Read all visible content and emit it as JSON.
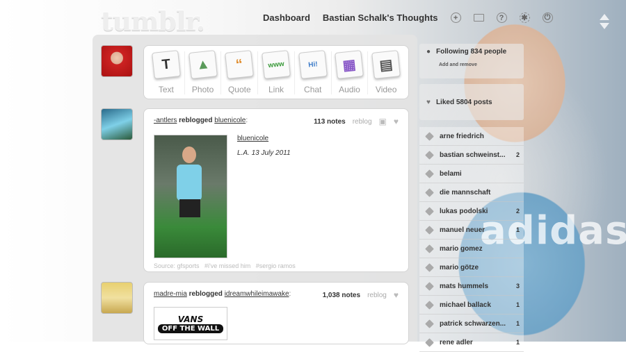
{
  "logo": "tumblr.",
  "nav": {
    "dashboard": "Dashboard",
    "blog": "Bastian Schalk's Thoughts"
  },
  "post_types": [
    {
      "label": "Text",
      "glyph": "T",
      "color": "#333"
    },
    {
      "label": "Photo",
      "glyph": "▲",
      "color": "#5a9a5a"
    },
    {
      "label": "Quote",
      "glyph": "“",
      "color": "#e08a2a"
    },
    {
      "label": "Link",
      "glyph": "www",
      "color": "#3a9a3a"
    },
    {
      "label": "Chat",
      "glyph": "Hi!",
      "color": "#3a7ac8"
    },
    {
      "label": "Audio",
      "glyph": "▦",
      "color": "#8a5ac8"
    },
    {
      "label": "Video",
      "glyph": "▤",
      "color": "#555"
    }
  ],
  "post1": {
    "user": "-antlers",
    "action": "reblogged",
    "source": "bluenicole",
    "notes": "113 notes",
    "reblog": "reblog",
    "caption_user": "bluenicole",
    "caption_text": "L.A. 13 July 2011",
    "tags": "Source: gfsports   #i've missed him   #sergio ramos"
  },
  "post2": {
    "user": "madre-mia",
    "action": "reblogged",
    "source": "idreamwhileimawake",
    "notes": "1,038 notes",
    "reblog": "reblog",
    "image_text_top": "VANS",
    "image_text_bottom": "OFF THE WALL"
  },
  "sidebar": {
    "following": "Following 834 people",
    "add_remove": "Add and remove",
    "liked": "Liked 5804 posts",
    "tags": [
      {
        "name": "arne friedrich",
        "count": ""
      },
      {
        "name": "bastian schweinst...",
        "count": "2"
      },
      {
        "name": "belami",
        "count": ""
      },
      {
        "name": "die mannschaft",
        "count": ""
      },
      {
        "name": "lukas podolski",
        "count": "2"
      },
      {
        "name": "manuel neuer",
        "count": "1"
      },
      {
        "name": "mario gomez",
        "count": ""
      },
      {
        "name": "mario götze",
        "count": ""
      },
      {
        "name": "mats hummels",
        "count": "3"
      },
      {
        "name": "michael ballack",
        "count": "1"
      },
      {
        "name": "patrick schwarzen...",
        "count": "1"
      },
      {
        "name": "rene adler",
        "count": "1"
      }
    ]
  }
}
